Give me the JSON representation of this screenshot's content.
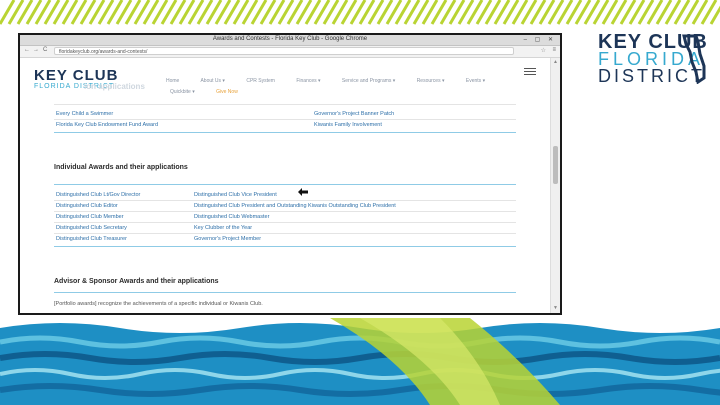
{
  "browser": {
    "window_title": "Awards and Contests - Florida Key Club - Google Chrome",
    "window_controls": "– ▢ ✕",
    "url": "floridakeyclub.org/awards-and-contests/",
    "back": "←",
    "forward": "→",
    "reload": "C",
    "star": "☆",
    "menu": "≡"
  },
  "brand_logo": {
    "line1": "KEY CLUB",
    "line2": "FLORIDA",
    "line3": "DISTRICT"
  },
  "site": {
    "logo_line1": "KEY CLUB",
    "logo_line2": "FLORIDA DISTRICT",
    "nav_items": [
      "Home",
      "About Us ▾",
      "CPR System",
      "Finances ▾",
      "Service and Programs ▾",
      "Resources ▾",
      "Events ▾"
    ],
    "nav_items_row2": [
      "Quickbite ▾",
      "Give Now"
    ],
    "partial_heading": "ion applications"
  },
  "club_rows": [
    [
      "Every Child a Swimmer",
      "Governor's Project Banner Patch"
    ],
    [
      "Florida Key Club Endowment Fund Award",
      "Kiwanis Family Involvement"
    ]
  ],
  "individual": {
    "title": "Individual Awards and their applications",
    "rows": [
      [
        "Distinguished Club Lt/Gov Director",
        "Distinguished Club Vice President"
      ],
      [
        "Distinguished Club Editor",
        "Distinguished Club President and Outstanding Kiwanis Outstanding Club President"
      ],
      [
        "Distinguished Club Member",
        "Distinguished Club Webmaster"
      ],
      [
        "Distinguished Club Secretary",
        "Key Clubber of the Year"
      ],
      [
        "Distinguished Club Treasurer",
        "Governor's Project Member"
      ]
    ]
  },
  "advisor": {
    "title": "Advisor & Sponsor Awards and their applications",
    "text": "[Portfolio awards] recognize the achievements of a specific individual or Kiwanis Club."
  },
  "colors": {
    "accent_blue": "#36a9cf",
    "navy": "#1d3557",
    "link": "#2d6fa8",
    "lime": "#b9d433"
  }
}
